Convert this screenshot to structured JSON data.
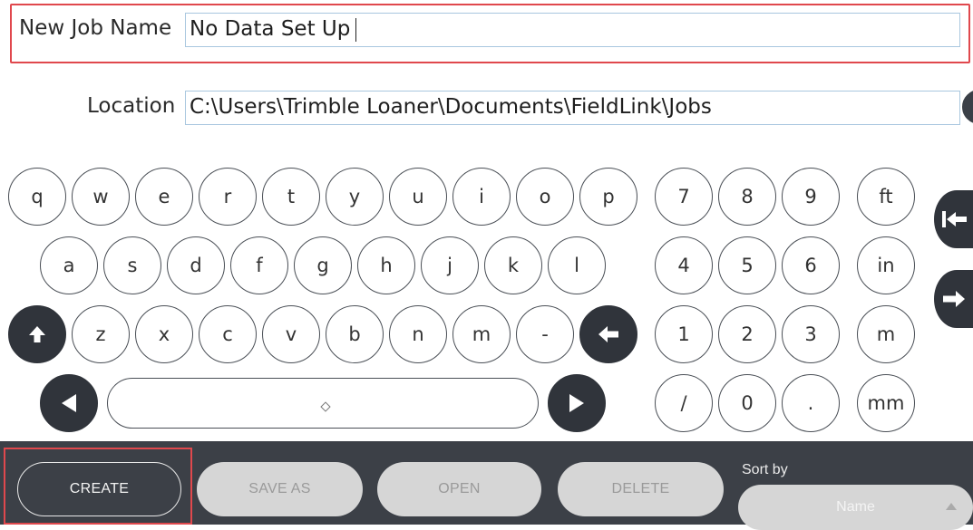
{
  "form": {
    "job_name_label": "New Job Name",
    "job_name_value": "No Data Set Up",
    "location_label": "Location",
    "location_value": "C:\\Users\\Trimble Loaner\\Documents\\FieldLink\\Jobs",
    "browse_icon": "folder-browse-icon"
  },
  "keyboard": {
    "row1": [
      "q",
      "w",
      "e",
      "r",
      "t",
      "y",
      "u",
      "i",
      "o",
      "p"
    ],
    "row2": [
      "a",
      "s",
      "d",
      "f",
      "g",
      "h",
      "j",
      "k",
      "l"
    ],
    "row3": [
      "z",
      "x",
      "c",
      "v",
      "b",
      "n",
      "m",
      "-"
    ],
    "numpad": [
      [
        "7",
        "8",
        "9"
      ],
      [
        "4",
        "5",
        "6"
      ],
      [
        "1",
        "2",
        "3"
      ],
      [
        "/",
        "0",
        "."
      ]
    ],
    "units": [
      "ft",
      "in",
      "m",
      "mm"
    ],
    "icons": {
      "shift": "shift-up-icon",
      "backspace": "backspace-arrow-icon",
      "cursor_left": "cursor-left-icon",
      "cursor_right": "cursor-right-icon",
      "side_top": "jump-to-start-icon",
      "side_bottom": "next-field-icon"
    }
  },
  "actions": {
    "create": "CREATE",
    "save_as": "SAVE AS",
    "open": "OPEN",
    "delete": "DELETE",
    "sort_label": "Sort by",
    "sort_value": "Name"
  },
  "colors": {
    "highlight": "#e0484d",
    "dark_key": "#30343b",
    "bottom_bar": "#3c4047",
    "disabled_button": "#d6d6d6"
  }
}
